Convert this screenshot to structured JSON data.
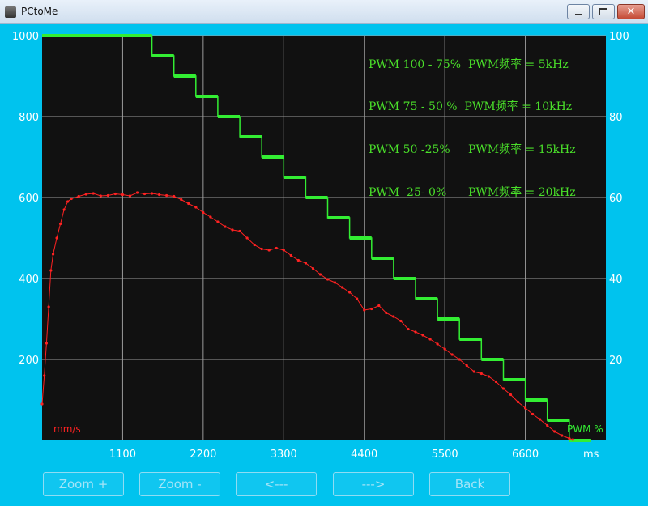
{
  "window": {
    "title": "PCtoMe"
  },
  "buttons": {
    "zoom_in": "Zoom +",
    "zoom_out": "Zoom -",
    "prev": "<---",
    "next": "--->",
    "back": "Back"
  },
  "colors": {
    "background": "#00c3ee",
    "plot_bg": "#111111",
    "grid": "#9a9a9a",
    "speed": "#ff2222",
    "pwm": "#33ee33",
    "labels": "#ffffff",
    "annot": "#4adf2a"
  },
  "chart_data": {
    "type": "line",
    "x": {
      "unit": "ms",
      "ticks": [
        1100,
        2200,
        3300,
        4400,
        5500,
        6600
      ],
      "range": [
        0,
        7700
      ]
    },
    "y_left": {
      "ticks": [
        200,
        400,
        600,
        800,
        1000
      ],
      "range": [
        0,
        1000
      ]
    },
    "y_right": {
      "ticks": [
        20,
        40,
        60,
        80,
        100
      ],
      "range": [
        0,
        100
      ]
    },
    "annotations": [
      "PWM 100 - 75%  PWM频率 = 5kHz",
      "PWM 75 - 50 %  PWM频率 = 10kHz",
      "PWM 50 -25%     PWM频率 = 15kHz",
      "PWM  25- 0%      PWM频率 = 20kHz"
    ],
    "left_series_label": "mm/s",
    "right_series_label": "PWM %",
    "series": [
      {
        "axis": "left",
        "values": [
          [
            0,
            90
          ],
          [
            30,
            160
          ],
          [
            60,
            240
          ],
          [
            90,
            330
          ],
          [
            120,
            420
          ],
          [
            150,
            460
          ],
          [
            200,
            500
          ],
          [
            250,
            535
          ],
          [
            300,
            570
          ],
          [
            350,
            590
          ],
          [
            400,
            597
          ],
          [
            500,
            603
          ],
          [
            600,
            608
          ],
          [
            700,
            610
          ],
          [
            800,
            604
          ],
          [
            900,
            605
          ],
          [
            1000,
            609
          ],
          [
            1100,
            607
          ],
          [
            1200,
            604
          ],
          [
            1300,
            612
          ],
          [
            1400,
            609
          ],
          [
            1500,
            610
          ],
          [
            1600,
            607
          ],
          [
            1700,
            605
          ],
          [
            1800,
            603
          ],
          [
            1900,
            595
          ],
          [
            2000,
            585
          ],
          [
            2100,
            576
          ],
          [
            2200,
            563
          ],
          [
            2300,
            552
          ],
          [
            2400,
            540
          ],
          [
            2500,
            528
          ],
          [
            2600,
            520
          ],
          [
            2700,
            517
          ],
          [
            2800,
            500
          ],
          [
            2900,
            483
          ],
          [
            3000,
            473
          ],
          [
            3100,
            470
          ],
          [
            3200,
            475
          ],
          [
            3300,
            470
          ],
          [
            3400,
            457
          ],
          [
            3500,
            445
          ],
          [
            3600,
            438
          ],
          [
            3700,
            425
          ],
          [
            3800,
            410
          ],
          [
            3900,
            398
          ],
          [
            4000,
            390
          ],
          [
            4100,
            378
          ],
          [
            4200,
            366
          ],
          [
            4300,
            350
          ],
          [
            4400,
            322
          ],
          [
            4500,
            325
          ],
          [
            4600,
            333
          ],
          [
            4700,
            315
          ],
          [
            4800,
            306
          ],
          [
            4900,
            295
          ],
          [
            5000,
            275
          ],
          [
            5100,
            268
          ],
          [
            5200,
            260
          ],
          [
            5300,
            250
          ],
          [
            5400,
            238
          ],
          [
            5500,
            226
          ],
          [
            5600,
            212
          ],
          [
            5700,
            200
          ],
          [
            5800,
            185
          ],
          [
            5900,
            170
          ],
          [
            6000,
            165
          ],
          [
            6100,
            158
          ],
          [
            6200,
            145
          ],
          [
            6300,
            128
          ],
          [
            6400,
            113
          ],
          [
            6500,
            95
          ],
          [
            6600,
            80
          ],
          [
            6700,
            65
          ],
          [
            6800,
            52
          ],
          [
            6900,
            37
          ],
          [
            7000,
            22
          ],
          [
            7100,
            12
          ],
          [
            7200,
            5
          ],
          [
            7250,
            2
          ]
        ]
      },
      {
        "axis": "right",
        "values": [
          [
            0,
            100
          ],
          [
            1500,
            100
          ],
          [
            1500,
            95
          ],
          [
            1800,
            95
          ],
          [
            1800,
            90
          ],
          [
            2100,
            90
          ],
          [
            2100,
            85
          ],
          [
            2400,
            85
          ],
          [
            2400,
            80
          ],
          [
            2700,
            80
          ],
          [
            2700,
            75
          ],
          [
            3000,
            75
          ],
          [
            3000,
            70
          ],
          [
            3300,
            70
          ],
          [
            3300,
            65
          ],
          [
            3600,
            65
          ],
          [
            3600,
            60
          ],
          [
            3900,
            60
          ],
          [
            3900,
            55
          ],
          [
            4200,
            55
          ],
          [
            4200,
            50
          ],
          [
            4500,
            50
          ],
          [
            4500,
            45
          ],
          [
            4800,
            45
          ],
          [
            4800,
            40
          ],
          [
            5100,
            40
          ],
          [
            5100,
            35
          ],
          [
            5400,
            35
          ],
          [
            5400,
            30
          ],
          [
            5700,
            30
          ],
          [
            5700,
            25
          ],
          [
            6000,
            25
          ],
          [
            6000,
            20
          ],
          [
            6300,
            20
          ],
          [
            6300,
            15
          ],
          [
            6600,
            15
          ],
          [
            6600,
            10
          ],
          [
            6900,
            10
          ],
          [
            6900,
            5
          ],
          [
            7200,
            5
          ],
          [
            7200,
            0
          ],
          [
            7500,
            0
          ]
        ]
      }
    ]
  }
}
